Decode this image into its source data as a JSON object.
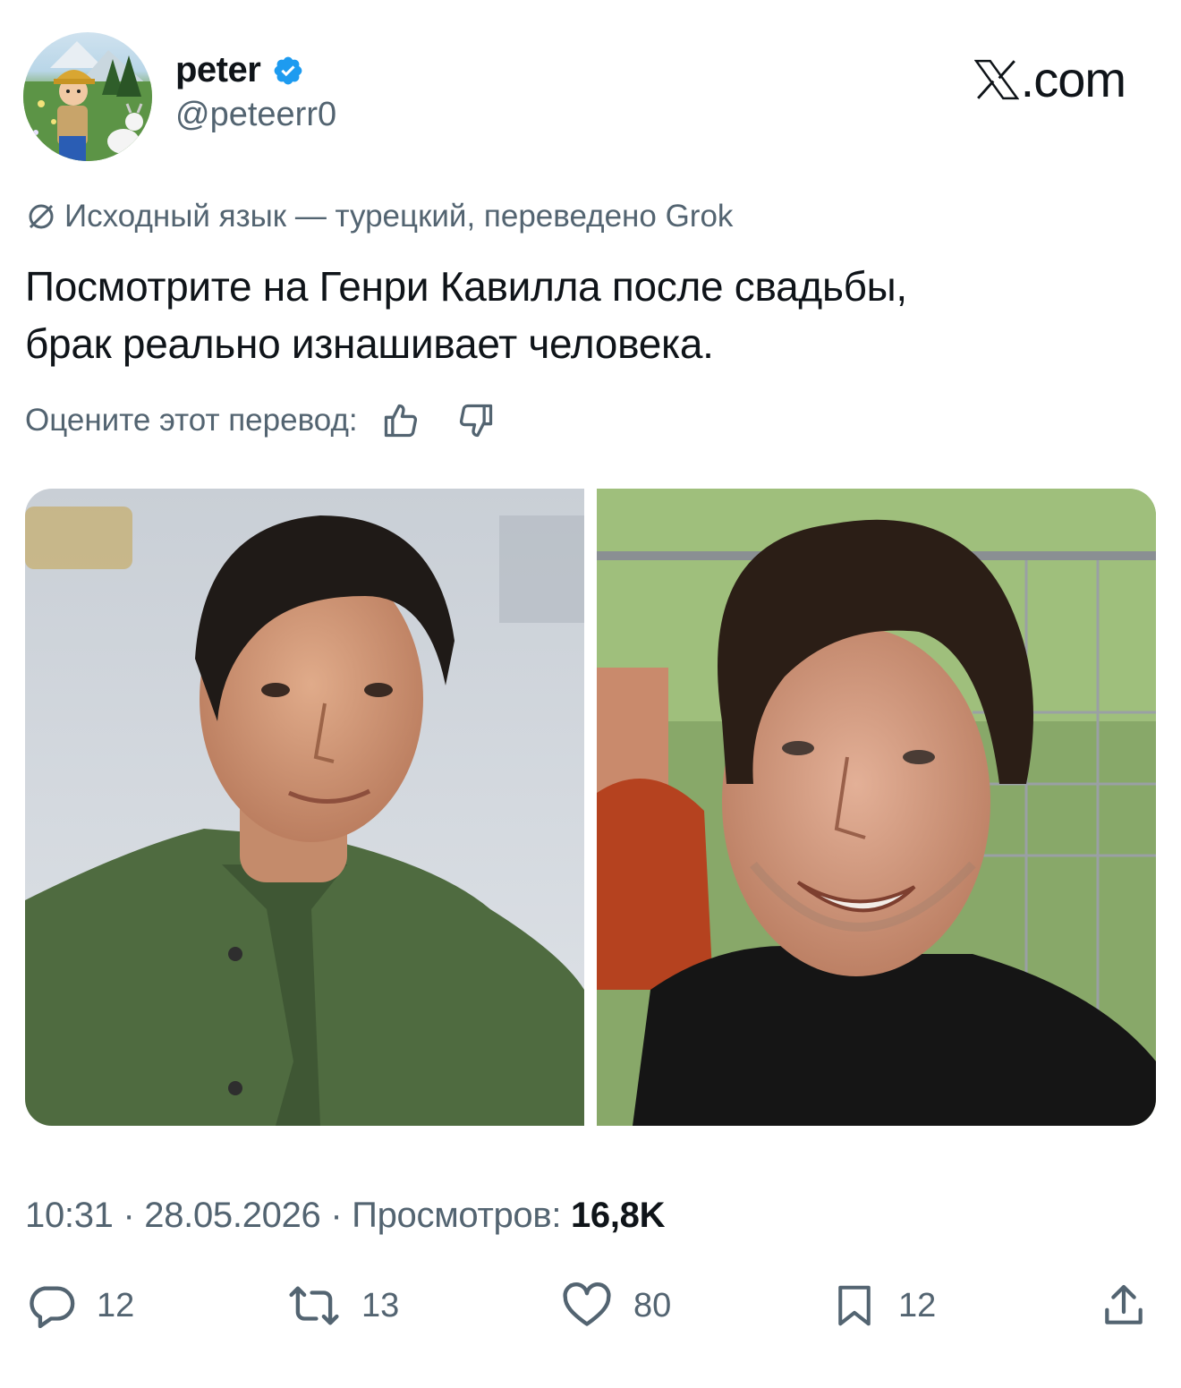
{
  "author": {
    "display_name": "peter",
    "handle": "@peteerr0",
    "verified": true,
    "avatar": "avatar-cartoon-boy-goat"
  },
  "brand": {
    "label": ".com",
    "logo": "x-logo-icon"
  },
  "translation": {
    "note": "Исходный язык — турецкий, переведено Grok",
    "icon": "translate-icon"
  },
  "tweet": {
    "line1": "Посмотрите на Генри Кавилла после свадьбы,",
    "line2": "брак реально изнашивает человека."
  },
  "rating": {
    "label": "Оцените этот перевод:",
    "icons": [
      "thumbs-up-icon",
      "thumbs-down-icon"
    ]
  },
  "media": [
    {
      "name": "photo-before",
      "description_icon": "portrait-green-shirt"
    },
    {
      "name": "photo-after",
      "description_icon": "portrait-black-shirt"
    }
  ],
  "meta": {
    "time": "10:31",
    "date": "28.05.2026",
    "views_label": "Просмотров:",
    "views_value": "16,8K",
    "sep": "·"
  },
  "actions": {
    "replies": "12",
    "reposts": "13",
    "likes": "80",
    "bookmarks": "12"
  },
  "colors": {
    "text": "#0f1419",
    "secondary": "#536471",
    "verified": "#1d9bf0"
  }
}
